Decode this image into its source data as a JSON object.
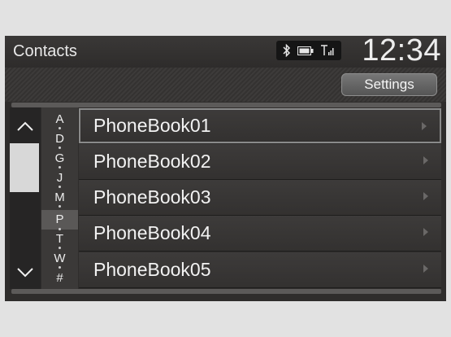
{
  "header": {
    "title": "Contacts",
    "clock": "12:34",
    "status_icons": [
      "bluetooth-icon",
      "battery-icon",
      "signal-icon"
    ]
  },
  "toolbar": {
    "settings_label": "Settings"
  },
  "alphabet_index": {
    "letters": [
      "A",
      "D",
      "G",
      "J",
      "M",
      "P",
      "T",
      "W",
      "#"
    ],
    "selected": "P"
  },
  "phonebooks": [
    {
      "label": "PhoneBook01"
    },
    {
      "label": "PhoneBook02"
    },
    {
      "label": "PhoneBook03"
    },
    {
      "label": "PhoneBook04"
    },
    {
      "label": "PhoneBook05"
    }
  ],
  "colors": {
    "background": "#2f2d2c",
    "accent": "#d8d8d8",
    "text": "#f2f2f2"
  }
}
